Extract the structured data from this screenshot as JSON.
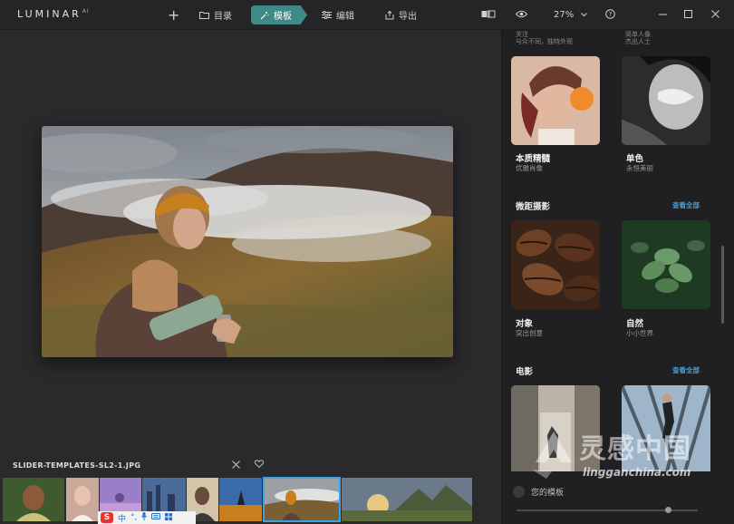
{
  "app": {
    "logo": "LUMINAR",
    "logo_sup": "AI"
  },
  "toolbar": {
    "add": "+",
    "catalog_label": "目录",
    "templates_label": "模板",
    "edit_label": "编辑",
    "export_label": "导出",
    "zoom": "27%"
  },
  "panel": {
    "clipped_left_title": "关注",
    "clipped_left_sub": "与众不同，独特外观",
    "clipped_right_title": "简单人像",
    "clipped_right_sub": "杰出人士",
    "cards_row1": [
      {
        "title": "本质精髓",
        "subtitle": "优雅肖像"
      },
      {
        "title": "单色",
        "subtitle": "永恒美丽"
      }
    ],
    "section_macro": {
      "title": "微距摄影",
      "see_all": "查看全部"
    },
    "cards_row2": [
      {
        "title": "对象",
        "subtitle": "突出创意"
      },
      {
        "title": "自然",
        "subtitle": "小小世界"
      }
    ],
    "section_film": {
      "title": "电影",
      "see_all": "查看全部"
    },
    "my_templates": "您的模板"
  },
  "filmstrip": {
    "filename": "SLIDER-TEMPLATES-SL2-1.JPG"
  },
  "ime": {
    "s": "S",
    "zh": "中"
  },
  "watermark": {
    "cn": "灵感中国",
    "url": "lingganchina.com"
  },
  "colors": {
    "accent": "#3f8a86",
    "link": "#3aa3e6",
    "selection": "#3aa3e6"
  }
}
